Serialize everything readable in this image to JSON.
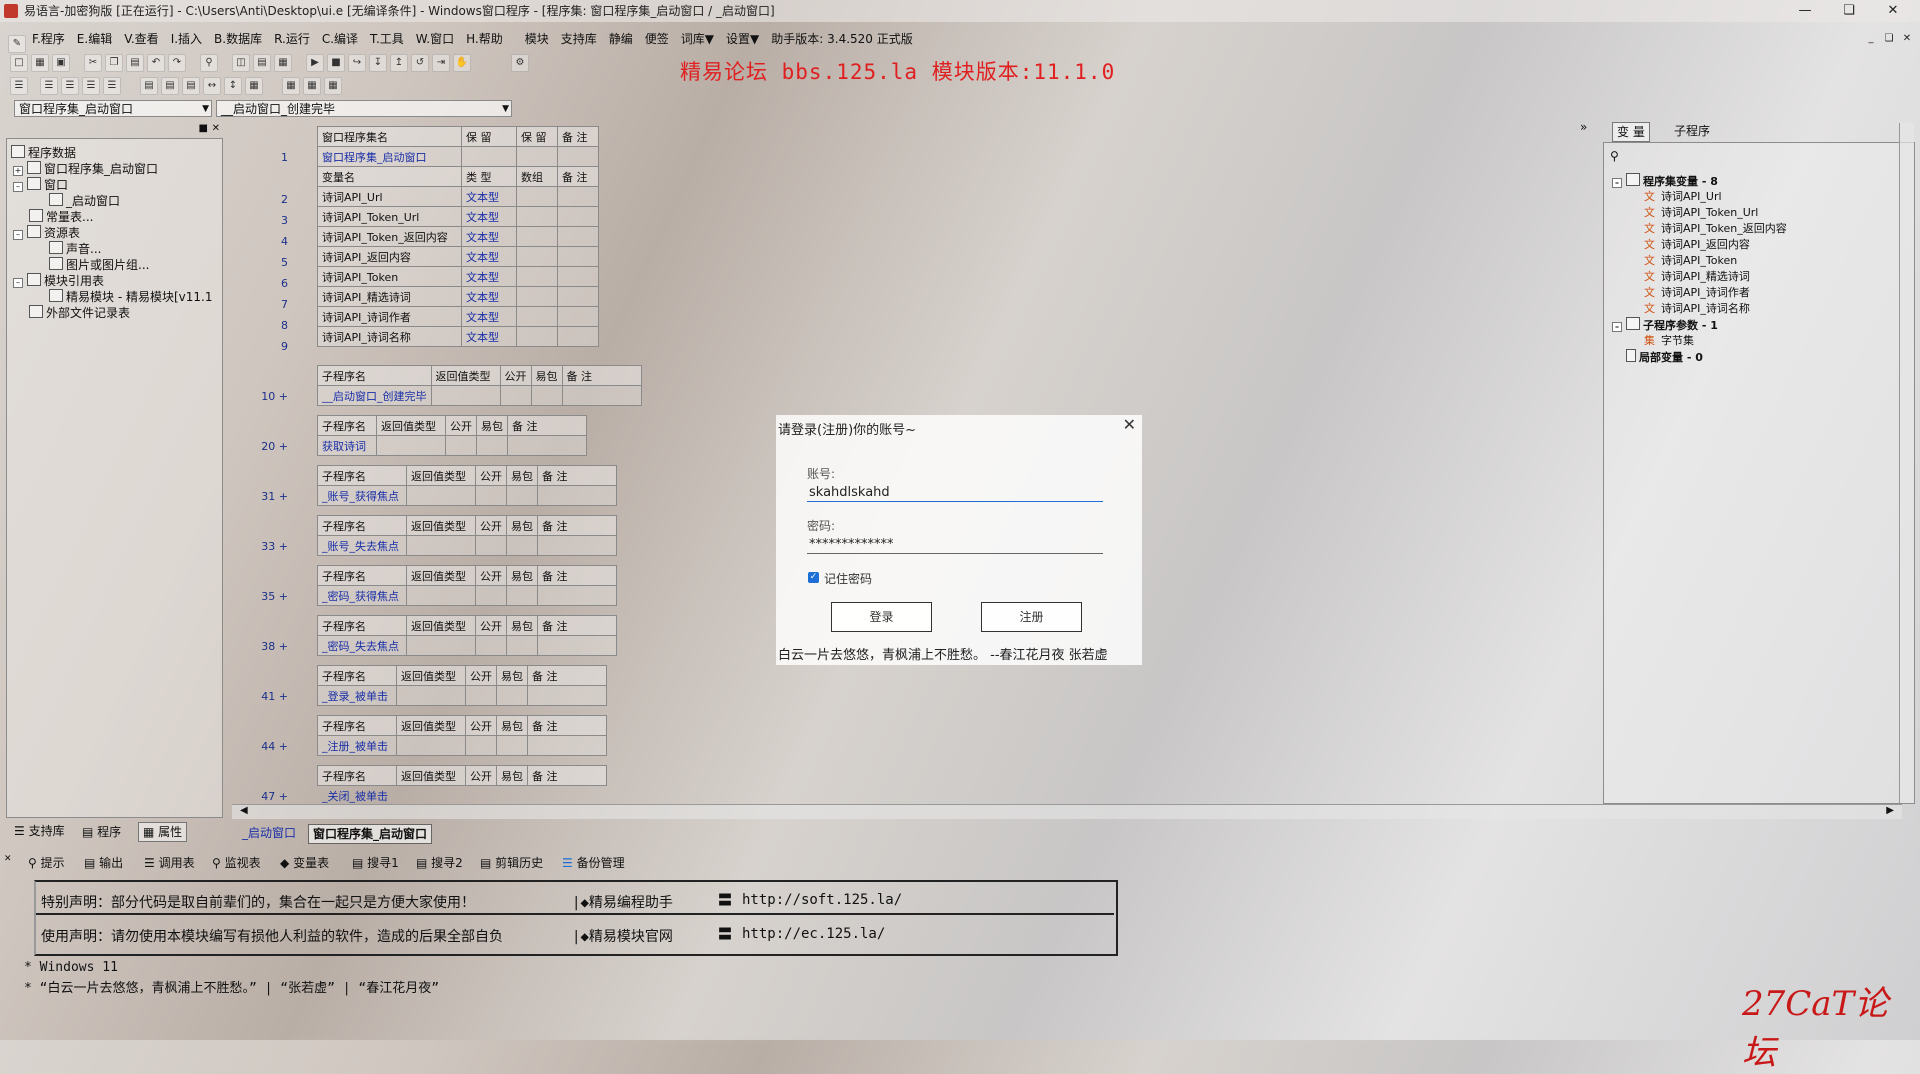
{
  "window": {
    "title": "易语言-加密狗版 [正在运行] - C:\\Users\\Anti\\Desktop\\ui.e [无编译条件] - Windows窗口程序 - [程序集: 窗口程序集_启动窗口 / _启动窗口]"
  },
  "menu": {
    "items": [
      "F.程序",
      "E.编辑",
      "V.查看",
      "I.插入",
      "B.数据库",
      "R.运行",
      "C.编译",
      "T.工具",
      "W.窗口",
      "H.帮助",
      "模块",
      "支持库",
      "静编",
      "便签",
      "词库▼",
      "设置▼",
      "助手版本: 3.4.520 正式版"
    ]
  },
  "banner": "精易论坛 bbs.125.la 模块版本:11.1.0",
  "combos": {
    "left": "窗口程序集_启动窗口",
    "right": "__启动窗口_创建完毕"
  },
  "tree": {
    "items": [
      "程序数据",
      "窗口程序集_启动窗口",
      "窗口",
      "_启动窗口",
      "常量表...",
      "资源表",
      "声音...",
      "图片或图片组...",
      "模块引用表",
      "精易模块 - 精易模块[v11.1",
      "外部文件记录表"
    ]
  },
  "left_tabs": [
    "支持库",
    "程序",
    "属性"
  ],
  "code": {
    "header_set": [
      "窗口程序集名",
      "保 留",
      "保 留",
      "备 注"
    ],
    "set_name": "窗口程序集_启动窗口",
    "header_vars": [
      "变量名",
      "类 型",
      "数组",
      "备 注"
    ],
    "var_type": "文本型",
    "vars": [
      "诗词API_Url",
      "诗词API_Token_Url",
      "诗词API_Token_返回内容",
      "诗词API_返回内容",
      "诗词API_Token",
      "诗词API_精选诗词",
      "诗词API_诗词作者",
      "诗词API_诗词名称"
    ],
    "line_nums": [
      "1",
      "2",
      "3",
      "4",
      "5",
      "6",
      "7",
      "8",
      "9"
    ],
    "header_sub": [
      "子程序名",
      "返回值类型",
      "公开",
      "易包",
      "备 注"
    ],
    "subs": [
      {
        "line": "10 +",
        "name": "__启动窗口_创建完毕"
      },
      {
        "line": "20 +",
        "name": "获取诗词"
      },
      {
        "line": "31 +",
        "name": "_账号_获得焦点"
      },
      {
        "line": "33 +",
        "name": "_账号_失去焦点"
      },
      {
        "line": "35 +",
        "name": "_密码_获得焦点"
      },
      {
        "line": "38 +",
        "name": "_密码_失去焦点"
      },
      {
        "line": "41 +",
        "name": "_登录_被单击"
      },
      {
        "line": "44 +",
        "name": "_注册_被单击"
      },
      {
        "line": "47 +",
        "name": "_关闭_被单击"
      }
    ]
  },
  "editor_tabs": [
    "_启动窗口",
    "窗口程序集_启动窗口"
  ],
  "right_panel": {
    "tabs": [
      "变 量",
      "子程序"
    ],
    "group1": "程序集变量 - 8",
    "vars": [
      "诗词API_Url",
      "诗词API_Token_Url",
      "诗词API_Token_返回内容",
      "诗词API_返回内容",
      "诗词API_Token",
      "诗词API_精选诗词",
      "诗词API_诗词作者",
      "诗词API_诗词名称"
    ],
    "group2": "子程序参数 - 1",
    "param": "字节集",
    "group3": "局部变量 - 0",
    "wen": "文",
    "ji": "集"
  },
  "dialog": {
    "title": "请登录(注册)你的账号~",
    "account_label": "账号:",
    "account_value": "skahdlskahd",
    "password_label": "密码:",
    "password_value": "*************",
    "remember_label": "记住密码",
    "remember_checked": true,
    "login_button": "登录",
    "register_button": "注册",
    "poem": "白云一片去悠悠，青枫浦上不胜愁。 --春江花月夜 张若虚"
  },
  "bottom_tabs": [
    "提示",
    "输出",
    "调用表",
    "监视表",
    "变量表",
    "搜寻1",
    "搜寻2",
    "剪辑历史",
    "备份管理"
  ],
  "output": {
    "line1_left": "特别声明：部分代码是取自前辈们的，集合在一起只是方便大家使用！",
    "line1_mid": "◆精易编程助手",
    "line1_url": "http://soft.125.la/",
    "line2_left": "使用声明：请勿使用本模块编写有损他人利益的软件，造成的后果全部自负",
    "line2_mid": "◆精易模块官网",
    "line2_url": "http://ec.125.la/",
    "eq": "〓",
    "log1": "* Windows 11",
    "log2": "* “白云一片去悠悠，青枫浦上不胜愁。” | “张若虚” | “春江花月夜”"
  },
  "watermark": "27CaT论坛",
  "colors": {
    "accent_red": "#e02020",
    "link_blue": "#1a2fa8",
    "focus_blue": "#1c6fd6"
  }
}
